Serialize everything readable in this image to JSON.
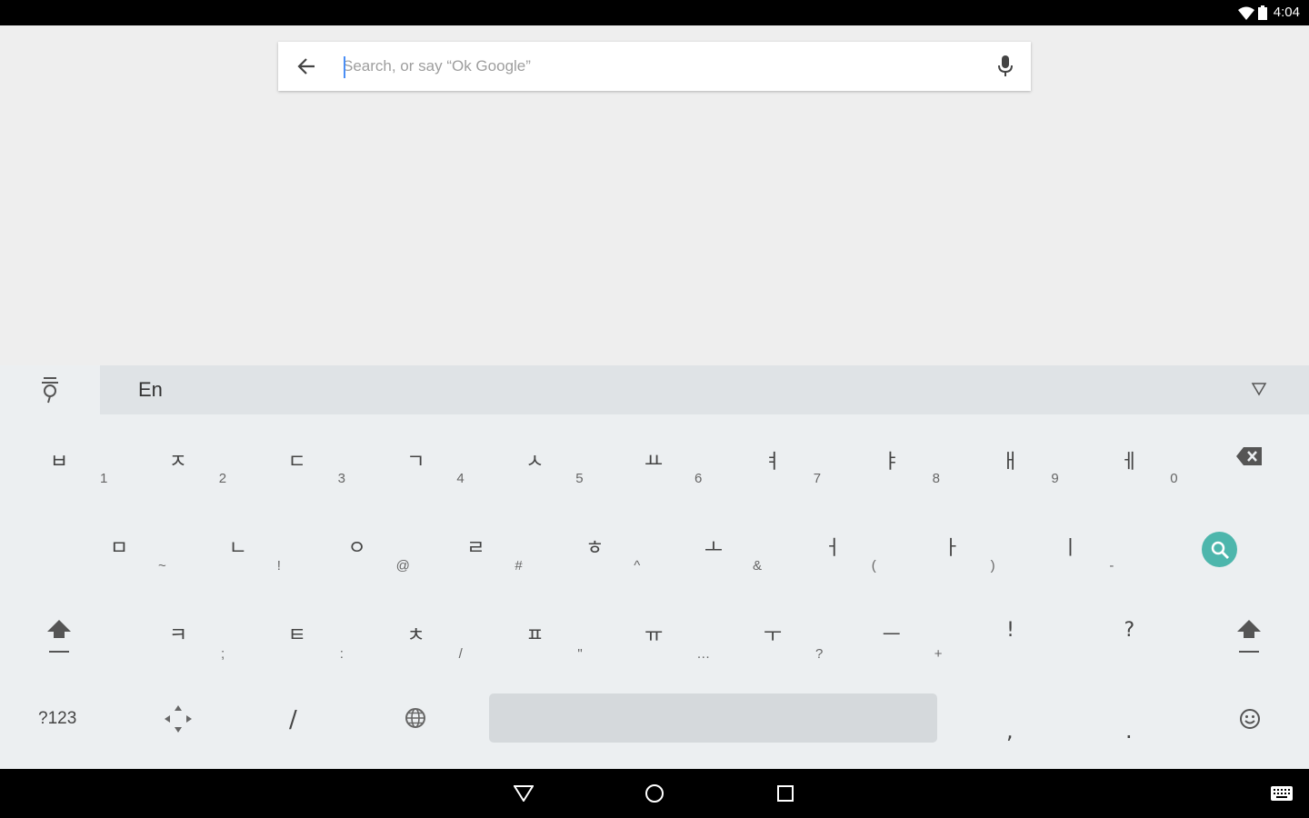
{
  "status": {
    "time": "4:04"
  },
  "search": {
    "placeholder": "Search, or say “Ok Google”",
    "value": ""
  },
  "suggestion_bar": {
    "ime_label": "ᄋ",
    "language": "En"
  },
  "keyboard": {
    "row1": [
      {
        "main": "ㅂ",
        "sub": "1"
      },
      {
        "main": "ㅈ",
        "sub": "2"
      },
      {
        "main": "ㄷ",
        "sub": "3"
      },
      {
        "main": "ㄱ",
        "sub": "4"
      },
      {
        "main": "ㅅ",
        "sub": "5"
      },
      {
        "main": "ㅛ",
        "sub": "6"
      },
      {
        "main": "ㅕ",
        "sub": "7"
      },
      {
        "main": "ㅑ",
        "sub": "8"
      },
      {
        "main": "ㅐ",
        "sub": "9"
      },
      {
        "main": "ㅔ",
        "sub": "0"
      }
    ],
    "row2": [
      {
        "main": "ㅁ",
        "sub": "~"
      },
      {
        "main": "ㄴ",
        "sub": "!"
      },
      {
        "main": "ㅇ",
        "sub": "@"
      },
      {
        "main": "ㄹ",
        "sub": "#"
      },
      {
        "main": "ㅎ",
        "sub": "^"
      },
      {
        "main": "ㅗ",
        "sub": "&"
      },
      {
        "main": "ㅓ",
        "sub": "("
      },
      {
        "main": "ㅏ",
        "sub": ")"
      },
      {
        "main": "ㅣ",
        "sub": "-"
      }
    ],
    "row3": [
      {
        "main": "ㅋ",
        "sub": ";"
      },
      {
        "main": "ㅌ",
        "sub": ":"
      },
      {
        "main": "ㅊ",
        "sub": "/"
      },
      {
        "main": "ㅍ",
        "sub": "\""
      },
      {
        "main": "ㅠ",
        "sub": "…"
      },
      {
        "main": "ㅜ",
        "sub": "?"
      },
      {
        "main": "ㅡ",
        "sub": "+"
      },
      {
        "main": "!",
        "sub": ""
      },
      {
        "main": "?",
        "sub": ""
      }
    ],
    "row4": {
      "symbols": "?123",
      "slash": "/",
      "comma": ",",
      "period": "."
    }
  },
  "colors": {
    "accent": "#4db6ac",
    "keyboard_bg": "#eceff1",
    "suggest_bg": "#dfe3e6",
    "space_bg": "#d5d9dc"
  }
}
